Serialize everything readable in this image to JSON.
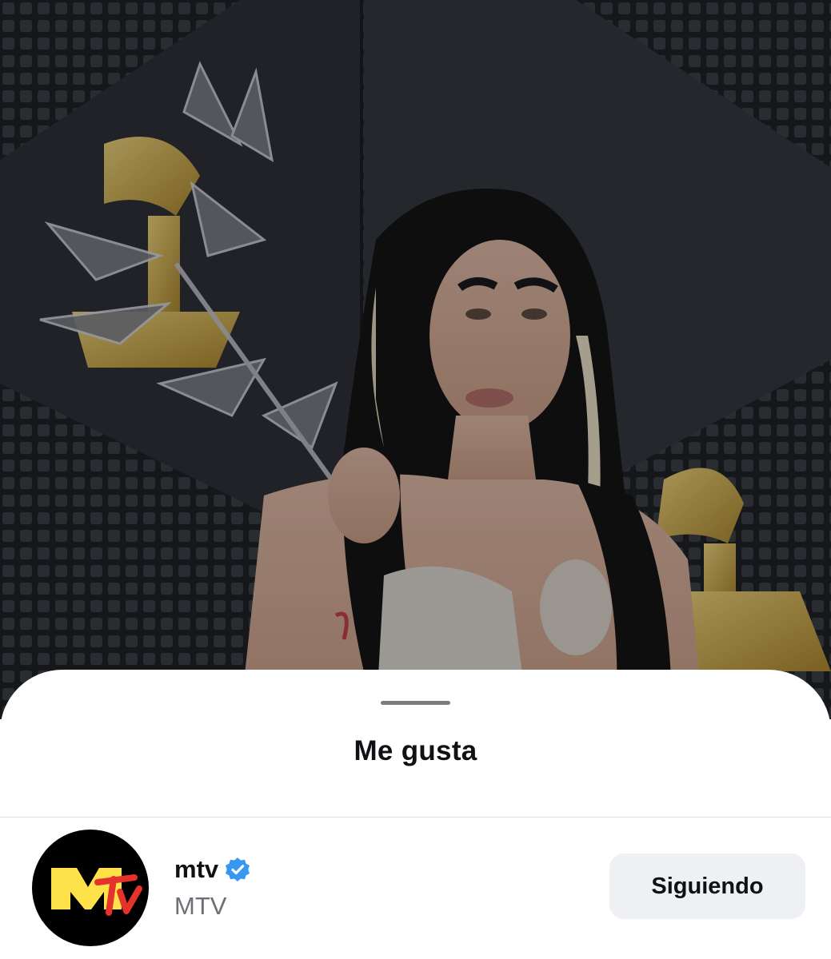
{
  "sheet": {
    "title": "Me gusta"
  },
  "likes": [
    {
      "username": "mtv",
      "display_name": "MTV",
      "verified": true,
      "follow_label": "Siguiendo",
      "avatar_icon": "mtv-logo-icon"
    }
  ],
  "colors": {
    "verified_badge": "#3897f0",
    "mtv_yellow": "#ffe14a",
    "mtv_red": "#e5322d"
  }
}
